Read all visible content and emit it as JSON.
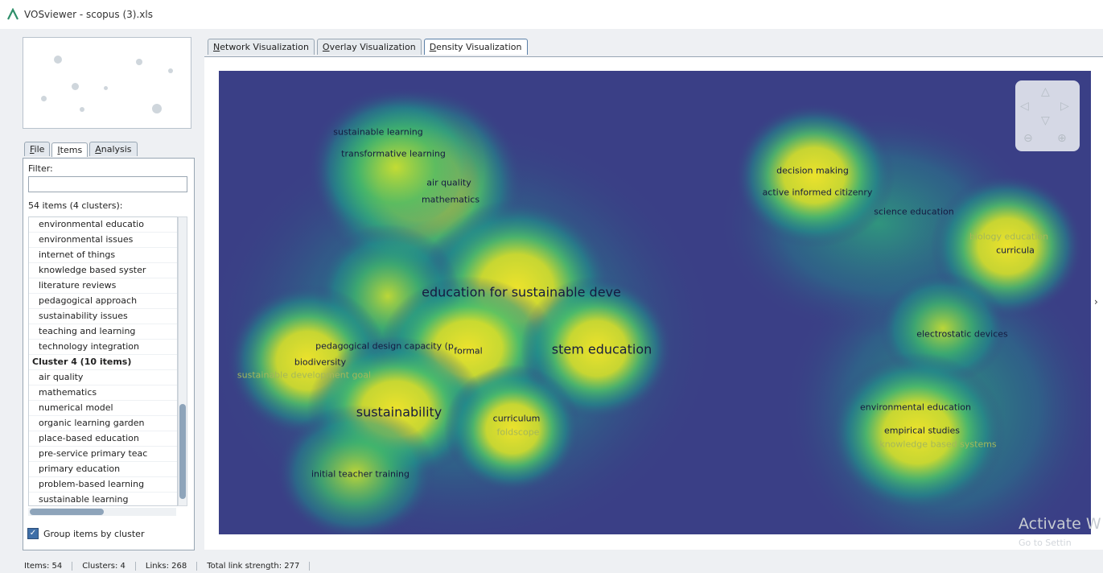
{
  "window": {
    "title": "VOSviewer - scopus (3).xls"
  },
  "left_panel": {
    "tabs": [
      {
        "key": "F",
        "rest": "ile"
      },
      {
        "key": "I",
        "rest": "tems"
      },
      {
        "key": "A",
        "rest": "nalysis"
      }
    ],
    "active_tab": "Items",
    "filter_label": "Filter:",
    "filter_value": "",
    "items_count": "54 items (4 clusters):",
    "list": [
      {
        "text": "environmental educatio",
        "header": false
      },
      {
        "text": "environmental issues",
        "header": false
      },
      {
        "text": "internet of things",
        "header": false
      },
      {
        "text": "knowledge based syster",
        "header": false
      },
      {
        "text": "literature reviews",
        "header": false
      },
      {
        "text": "pedagogical approach",
        "header": false
      },
      {
        "text": "sustainability issues",
        "header": false
      },
      {
        "text": "teaching and learning",
        "header": false
      },
      {
        "text": "technology integration",
        "header": false
      },
      {
        "text": "Cluster 4 (10 items)",
        "header": true
      },
      {
        "text": "air quality",
        "header": false
      },
      {
        "text": "mathematics",
        "header": false
      },
      {
        "text": "numerical model",
        "header": false
      },
      {
        "text": "organic learning garden",
        "header": false
      },
      {
        "text": "place-based education",
        "header": false
      },
      {
        "text": "pre-service primary teac",
        "header": false
      },
      {
        "text": "primary education",
        "header": false
      },
      {
        "text": "problem-based learning",
        "header": false
      },
      {
        "text": "sustainable learning",
        "header": false
      },
      {
        "text": "transformative learning",
        "header": false
      }
    ],
    "group_by_cluster": "Group items by cluster"
  },
  "viz_tabs": [
    {
      "key": "N",
      "rest": "etwork Visualization"
    },
    {
      "key": "O",
      "rest": "verlay Visualization"
    },
    {
      "key": "D",
      "rest": "ensity Visualization"
    }
  ],
  "active_viz_tab": "Density Visualization",
  "density_map": {
    "colors": {
      "background": "#3a3f86",
      "low": "#1f8f8b",
      "mid": "#3fbf6a",
      "high": "#e8e22a"
    },
    "labels": [
      {
        "text": "sustainable learning",
        "size": 11,
        "pale": false
      },
      {
        "text": "transformative learning",
        "size": 11,
        "pale": false
      },
      {
        "text": "air quality",
        "size": 11,
        "pale": false
      },
      {
        "text": "mathematics",
        "size": 11,
        "pale": false
      },
      {
        "text": "education for sustainable deve",
        "size": 16,
        "pale": false
      },
      {
        "text": "pedagogical design capacity (p",
        "size": 11,
        "pale": false
      },
      {
        "text": "biodiversity",
        "size": 11,
        "pale": false
      },
      {
        "text": "sustainable development goal",
        "size": 11,
        "pale": true
      },
      {
        "text": "formal",
        "size": 11,
        "pale": false
      },
      {
        "text": "stem education",
        "size": 16,
        "pale": false
      },
      {
        "text": "sustainability",
        "size": 16,
        "pale": false
      },
      {
        "text": "curriculum",
        "size": 11,
        "pale": false
      },
      {
        "text": "foldscope",
        "size": 11,
        "pale": true
      },
      {
        "text": "initial teacher training",
        "size": 11,
        "pale": false
      },
      {
        "text": "decision making",
        "size": 11,
        "pale": false
      },
      {
        "text": "active informed citizenry",
        "size": 11,
        "pale": false
      },
      {
        "text": "science education",
        "size": 11,
        "pale": false
      },
      {
        "text": "biology education",
        "size": 11,
        "pale": true
      },
      {
        "text": "curricula",
        "size": 11,
        "pale": false
      },
      {
        "text": "electrostatic devices",
        "size": 11,
        "pale": false
      },
      {
        "text": "environmental education",
        "size": 11,
        "pale": false
      },
      {
        "text": "empirical studies",
        "size": 11,
        "pale": false
      },
      {
        "text": "knowledge based systems",
        "size": 11,
        "pale": true
      }
    ]
  },
  "watermark": {
    "title": "Activate W",
    "subtitle": "Go to Settin"
  },
  "status_bar": {
    "items": "Items: 54",
    "clusters": "Clusters: 4",
    "links": "Links: 268",
    "strength": "Total link strength: 277"
  }
}
